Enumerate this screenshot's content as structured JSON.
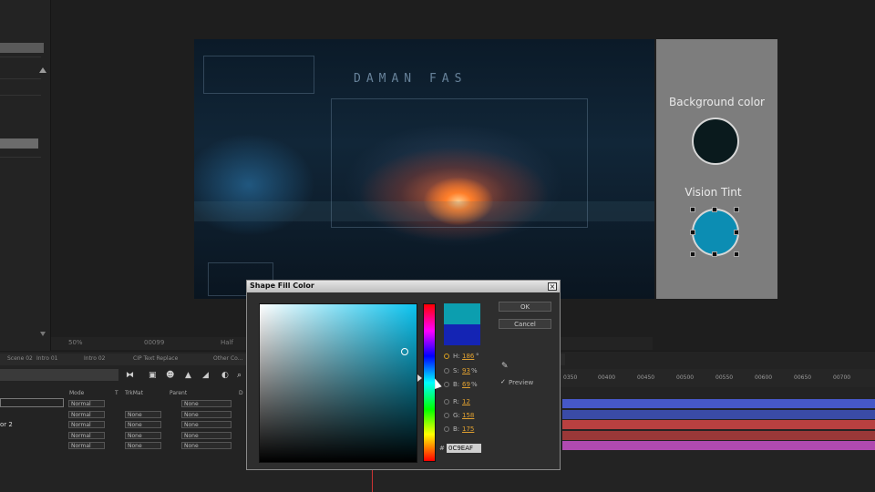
{
  "comp": {
    "title": "DAMAN FAS",
    "background_label": "Background color",
    "background_color": "#0a1a1d",
    "vt_label": "Vision Tint",
    "vt_color": "#0c8db3"
  },
  "viewer": {
    "zoom": "50%",
    "timecode": "00099",
    "resolution": "Half"
  },
  "timeline": {
    "tabs": [
      "Scene 02",
      "Intro 01",
      "Intro 02",
      "CIP Text Replace",
      "Other Co..."
    ],
    "columns": {
      "mode": "Mode",
      "t": "T",
      "trkmat": "TrkMat",
      "parent": "Parent",
      "d": "D"
    },
    "layer_name": "or 2",
    "rows": [
      {
        "mode": "Normal",
        "trkmat": "",
        "parent": "None"
      },
      {
        "mode": "Normal",
        "trkmat": "None",
        "parent": "None"
      },
      {
        "mode": "Normal",
        "trkmat": "None",
        "parent": "None"
      },
      {
        "mode": "Normal",
        "trkmat": "None",
        "parent": "None"
      },
      {
        "mode": "Normal",
        "trkmat": "None",
        "parent": "None"
      }
    ],
    "ruler": [
      "0350",
      "00400",
      "00450",
      "00500",
      "00550",
      "00600",
      "00650",
      "00700"
    ],
    "bar_colors": [
      "#4658c8",
      "#3a4ba6",
      "#b84040",
      "#9a3838",
      "#b04ab0"
    ]
  },
  "dialog": {
    "title": "Shape Fill Color",
    "close": "×",
    "ok": "OK",
    "cancel": "Cancel",
    "new_color": "#0c9eaf",
    "old_color": "#1424b4",
    "fields": [
      {
        "label": "H:",
        "value": "186",
        "unit": "°",
        "selected": true
      },
      {
        "label": "S:",
        "value": "93",
        "unit": "%",
        "selected": false
      },
      {
        "label": "B:",
        "value": "69",
        "unit": "%",
        "selected": false
      },
      {
        "label": "R:",
        "value": "12",
        "unit": "",
        "selected": false
      },
      {
        "label": "G:",
        "value": "158",
        "unit": "",
        "selected": false
      },
      {
        "label": "B:",
        "value": "175",
        "unit": "",
        "selected": false
      }
    ],
    "hex_label": "#",
    "hex_value": "0C9EAF",
    "preview_label": "Preview",
    "preview_checked": "✓"
  }
}
